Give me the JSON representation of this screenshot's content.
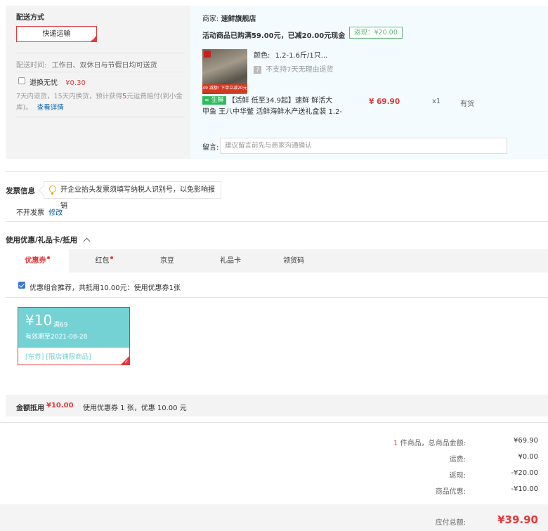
{
  "shipping": {
    "title": "配送方式",
    "method_button": "快递运输",
    "time_label": "配送时间:",
    "time_value": "工作日、双休日与节假日均可送货",
    "insurance_label": "退换无忧",
    "insurance_price": "¥0.30",
    "insurance_desc_1": "7天内退货，15天内换货，预计获得",
    "insurance_desc_red": "5",
    "insurance_desc_2": "元运费赔付(到小金库)。",
    "insurance_link": "查看详情"
  },
  "order": {
    "merchant_label": "商家:",
    "merchant_name": "速鲜旗舰店",
    "promo_text": "活动商品已购满59.00元，已减20.00元现金",
    "cashback_badge": "返现：¥20.00",
    "product": {
      "color_label": "颜色:",
      "color_value": "1.2-1.6斤/1只...",
      "no_return_icon_text": "7",
      "no_return_text": "不支持7天无理由退货",
      "fresh_tag": "生鲜",
      "thumb_badge": "49 减额! 下单立减20元",
      "title_line1": "【活鲜 低至34.9起】速鲜 鲜活大",
      "title_line2": "甲鱼 王八中华鳖 活鲜海鲜水产送礼盒装 1.2-",
      "price": "¥ 69.90",
      "quantity": "x1",
      "stock": "有货"
    },
    "message_label": "留言:",
    "message_placeholder": "建议留言前先与商家沟通确认"
  },
  "invoice": {
    "title": "发票信息",
    "tip": "开企业抬头发票须填写纳税人识别号，以免影响报销",
    "value": "不开发票",
    "edit_link": "修改"
  },
  "discount": {
    "title": "使用优惠/礼品卡/抵用",
    "tabs": [
      {
        "label": "优惠券",
        "dot": true
      },
      {
        "label": "红包",
        "dot": true
      },
      {
        "label": "京豆",
        "dot": false
      },
      {
        "label": "礼品卡",
        "dot": false
      },
      {
        "label": "领货码",
        "dot": false
      }
    ],
    "recommend_text": "优惠组合推荐，共抵用10.00元：使用优惠券1张",
    "coupon": {
      "amount": "¥10",
      "condition": "满69",
      "expiry": "有效期至2021-08-28",
      "scope": "[东券]  [限店铺限商品]"
    },
    "summary_label": "金额抵用",
    "summary_amount": "¥10.00",
    "summary_detail": "使用优惠券 1 张，优惠 10.00 元"
  },
  "totals": {
    "count": "1",
    "count_suffix": " 件商品，总商品金额:",
    "goods_amount": "¥69.90",
    "shipping_label": "运费:",
    "shipping_amount": "¥0.00",
    "cashback_label": "返现:",
    "cashback_amount": "-¥20.00",
    "discount_label": "商品优惠:",
    "discount_amount": "-¥10.00",
    "payable_label": "应付总额:",
    "payable_amount": "¥39.90"
  },
  "colors": {
    "accent": "#e4393c",
    "coupon": "#74d2d4",
    "fresh": "#2fbb5d",
    "cashback": "#5fb878"
  }
}
